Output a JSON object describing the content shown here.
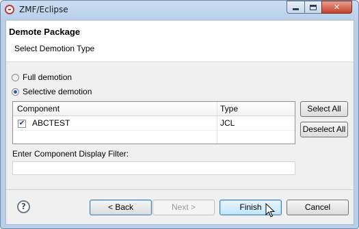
{
  "window": {
    "title": "ZMF/Eclipse"
  },
  "header": {
    "title": "Demote Package",
    "subtitle": "Select Demotion Type"
  },
  "options": {
    "full_label": "Full demotion",
    "selective_label": "Selective demotion",
    "selected": "selective"
  },
  "table": {
    "columns": [
      "Component",
      "Type"
    ],
    "rows": [
      {
        "component": "ABCTEST",
        "type": "JCL",
        "checked": true
      }
    ]
  },
  "side_buttons": {
    "select_all": "Select All",
    "deselect_all": "Deselect All"
  },
  "filter": {
    "label": "Enter Component Display Filter:",
    "value": ""
  },
  "footer": {
    "help": "?",
    "back_label": "< Back",
    "next_label": "Next >",
    "finish_label": "Finish",
    "cancel_label": "Cancel"
  },
  "icons": {
    "app": "zmf-eclipse-icon",
    "minimize": "minimize-icon",
    "maximize": "maximize-icon",
    "close": "close-icon",
    "help": "help-icon",
    "cursor": "mouse-pointer-icon",
    "check": "checkmark-icon"
  }
}
